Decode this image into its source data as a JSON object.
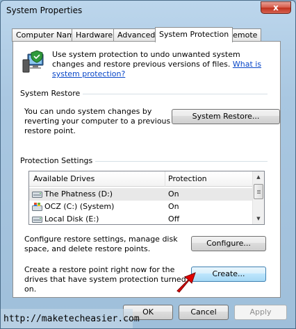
{
  "window": {
    "title": "System Properties",
    "close_glyph": "x"
  },
  "tabs": [
    {
      "label": "Computer Name"
    },
    {
      "label": "Hardware"
    },
    {
      "label": "Advanced"
    },
    {
      "label": "System Protection",
      "active": true
    },
    {
      "label": "Remote"
    }
  ],
  "intro": {
    "text": "Use system protection to undo unwanted system changes and restore previous versions of files.",
    "link": "What is system protection?"
  },
  "system_restore": {
    "heading": "System Restore",
    "description": "You can undo system changes by reverting your computer to a previous restore point.",
    "button": "System Restore..."
  },
  "protection": {
    "heading": "Protection Settings",
    "columns": [
      "Available Drives",
      "Protection"
    ],
    "drives": [
      {
        "name": "The Phatness (D:)",
        "protection": "On",
        "icon": "drive-icon",
        "selected": true
      },
      {
        "name": "OCZ (C:) (System)",
        "protection": "On",
        "icon": "windows-drive-icon"
      },
      {
        "name": "Local Disk (E:)",
        "protection": "Off",
        "icon": "drive-icon"
      }
    ],
    "configure_text": "Configure restore settings, manage disk space, and delete restore points.",
    "configure_button": "Configure...",
    "create_text": "Create a restore point right now for the drives that have system protection turned on.",
    "create_button": "Create..."
  },
  "footer": {
    "ok": "OK",
    "cancel": "Cancel",
    "apply": "Apply"
  },
  "watermark": "http://maketecheasier.com",
  "colors": {
    "link": "#0645c8",
    "arrow": "#e00000",
    "selection": "#e8e8e8"
  }
}
